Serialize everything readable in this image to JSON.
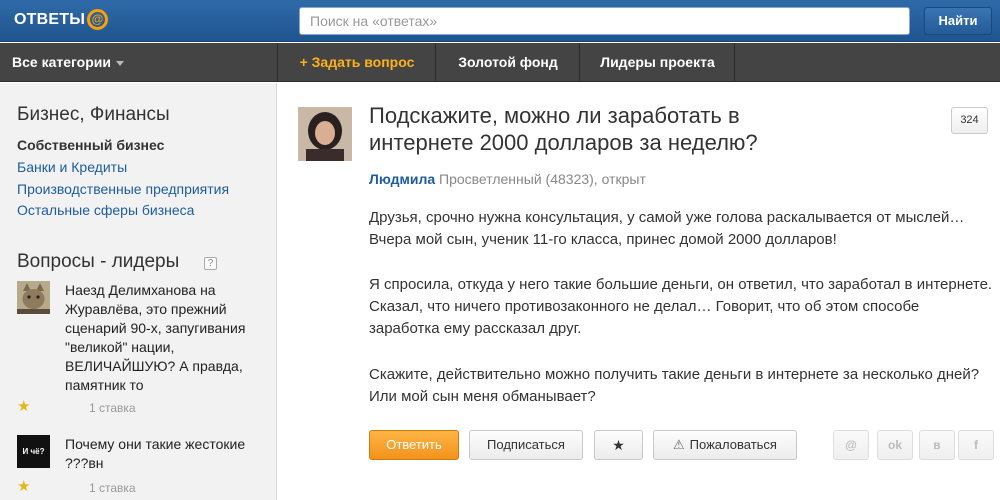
{
  "header": {
    "logo_text": "ОТВЕТЫ",
    "logo_at": "@",
    "search_placeholder": "Поиск на «ответах»",
    "search_button": "Найти"
  },
  "nav": {
    "categories": "Все категории",
    "ask": "+ Задать вопрос",
    "gold": "Золотой фонд",
    "leaders": "Лидеры проекта"
  },
  "sidebar": {
    "section_title": "Бизнес, Финансы",
    "current": "Собственный бизнес",
    "links": [
      "Банки и Кредиты",
      "Производственные предприятия",
      "Остальные сферы бизнеса"
    ],
    "leaders_title": "Вопросы - лидеры",
    "leaders": [
      {
        "text": "Наезд Делимханова на Журавлёва, это прежний сценарий 90-х, запугивания \"великой\" нации, ВЕЛИЧАЙШУЮ? А правда, памятник то",
        "meta": "1 ставка"
      },
      {
        "text": "Почему они такие жестокие ???вн",
        "meta": "1 ставка",
        "avatar_text": "И чё?"
      }
    ]
  },
  "question": {
    "title": "Подскажите, можно ли заработать в интернете 2000 долларов за неделю?",
    "count": "324",
    "author_name": "Людмила",
    "author_info": "Просветленный (48323), открыт",
    "paragraphs": [
      "Друзья, срочно нужна консультация, у самой уже голова раскалывается от мыслей… Вчера мой сын, ученик 11-го класса, принес домой 2000 долларов!",
      "Я спросила, откуда у него такие большие деньги, он ответил, что заработал в интернете. Сказал, что ничего противозаконного не делал… Говорит, что об этом способе заработка ему рассказал друг.",
      "Скажите, действительно можно получить такие деньги в интернете за несколько дней? Или мой сын меня обманывает?"
    ]
  },
  "actions": {
    "answer": "Ответить",
    "subscribe": "Подписаться",
    "star": "★",
    "report": "Пожаловаться",
    "social": [
      "@",
      "ok",
      "в",
      "f"
    ]
  },
  "colors": {
    "header_blue": "#2f6aa8",
    "nav_dark": "#444444",
    "accent_orange": "#f2921a",
    "link_blue": "#1d5c9e"
  }
}
